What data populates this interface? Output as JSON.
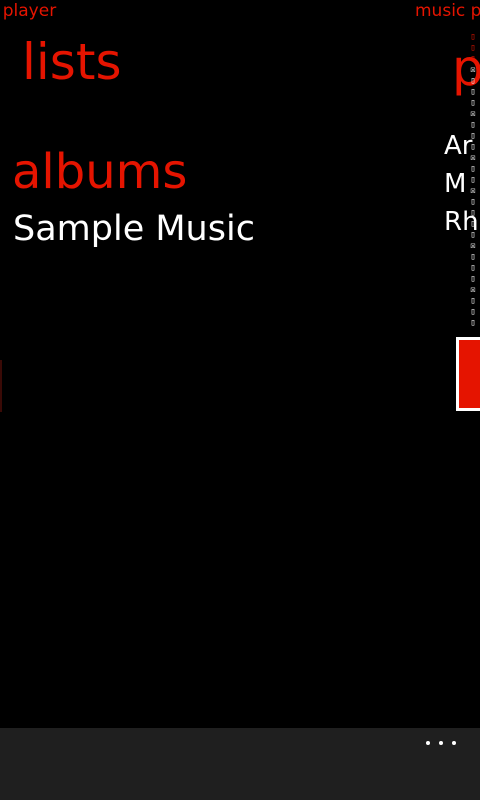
{
  "app": {
    "title_left": "c player",
    "title_right": "music p"
  },
  "pivot": {
    "current_header": "lists",
    "next_header": "p"
  },
  "lists_page": {
    "section_title": "albums",
    "items": [
      "Sample Music"
    ]
  },
  "next_page": {
    "items": [
      {
        "text": "Ar",
        "color": "#e51400"
      },
      {
        "text": "M",
        "color": "#ffffff"
      },
      {
        "text": "Rh",
        "color": "#ffffff"
      }
    ]
  },
  "appbar": {
    "more_icon": "ellipsis-icon"
  },
  "colors": {
    "accent": "#e51400",
    "background": "#000000",
    "appbar": "#1f1f1f",
    "text": "#ffffff"
  }
}
